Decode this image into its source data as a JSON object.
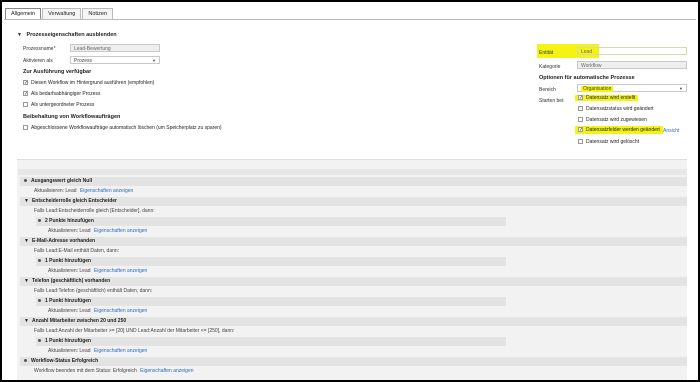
{
  "tabs": [
    "Allgemein",
    "Verwaltung",
    "Notizen"
  ],
  "section_title": "Prozesseigenschaften ausblenden",
  "form": {
    "process_name_label": "Prozessname",
    "required_mark": "*",
    "process_name_value": "Lead-Bewertung",
    "activate_as_label": "Aktivieren als",
    "activate_as_value": "Prozess",
    "run_heading": "Zur Ausführung verfügbar",
    "run_options": [
      {
        "label": "Diesen Workflow im Hintergrund ausführen (empfohlen)",
        "checked": true
      },
      {
        "label": "Als bedarfsabhängiger Prozess",
        "checked": true
      },
      {
        "label": "Als untergeordneter Prozess",
        "checked": false
      }
    ],
    "retention_heading": "Beibehaltung von Workflowaufträgen",
    "retention_option": {
      "label": "Abgeschlossene Workflowaufträge automatisch löschen (um Speicherplatz zu sparen)",
      "checked": false
    }
  },
  "right": {
    "entity_label": "Entität",
    "entity_value": "Lead",
    "category_label": "Kategorie",
    "category_value": "Workflow",
    "options_heading": "Optionen für automatische Prozesse",
    "scope_label": "Bereich",
    "scope_value": "Organisation",
    "start_label": "Starten bei:",
    "start_options": [
      {
        "label": "Datensatz wird erstellt",
        "checked": true,
        "highlight": true
      },
      {
        "label": "Datensatzstatus wird geändert",
        "checked": false,
        "highlight": false
      },
      {
        "label": "Datensatz wird zugewiesen",
        "checked": false,
        "highlight": false
      },
      {
        "label": "Datensatzfelder werden geändert",
        "checked": true,
        "highlight": true
      },
      {
        "label": "Datensatz wird gelöscht",
        "checked": false,
        "highlight": false
      }
    ],
    "select_link": "Ansicht"
  },
  "highlight_color": "#f4f414",
  "steps": [
    {
      "kind": "head",
      "marker": "dot",
      "text": "Ausgangswert gleich Null",
      "indent": 0
    },
    {
      "kind": "sub",
      "text": "Aktualisieren:",
      "entity": "Lead",
      "link": "Eigenschaften anzeigen",
      "indent": 0
    },
    {
      "kind": "head",
      "marker": "tri",
      "text": "Entscheiderrolle gleich Entscheider",
      "indent": 0
    },
    {
      "kind": "sub",
      "text": "Falls Lead:Entscheiderrolle gleich [Entscheider], dann:",
      "indent": 0
    },
    {
      "kind": "head",
      "marker": "dot",
      "text": "2 Punkte hinzufügen",
      "indent": 1
    },
    {
      "kind": "sub",
      "text": "Aktualisieren:",
      "entity": "Lead",
      "link": "Eigenschaften anzeigen",
      "indent": 1
    },
    {
      "kind": "head",
      "marker": "tri",
      "text": "E-Mail-Adresse vorhanden",
      "indent": 0
    },
    {
      "kind": "sub",
      "text": "Falls Lead:E-Mail enthält Daten, dann:",
      "indent": 0
    },
    {
      "kind": "head",
      "marker": "dot",
      "text": "1 Punkt hinzufügen",
      "indent": 1
    },
    {
      "kind": "sub",
      "text": "Aktualisieren:",
      "entity": "Lead",
      "link": "Eigenschaften anzeigen",
      "indent": 1
    },
    {
      "kind": "head",
      "marker": "tri",
      "text": "Telefon (geschäftlich) vorhanden",
      "indent": 0
    },
    {
      "kind": "sub",
      "text": "Falls Lead:Telefon (geschäftlich) enthält Daten, dann:",
      "indent": 0
    },
    {
      "kind": "head",
      "marker": "dot",
      "text": "1 Punkt hinzufügen",
      "indent": 1
    },
    {
      "kind": "sub",
      "text": "Aktualisieren:",
      "entity": "Lead",
      "link": "Eigenschaften anzeigen",
      "indent": 1
    },
    {
      "kind": "head",
      "marker": "tri",
      "text": "Anzahl Mitarbeiter zwischen 20 und 250",
      "indent": 0
    },
    {
      "kind": "sub",
      "text": "Falls Lead:Anzahl der Mitarbeiter >= [20] UND Lead:Anzahl der Mitarbeiter <= [250], dann:",
      "indent": 0
    },
    {
      "kind": "head",
      "marker": "dot",
      "text": "1 Punkt hinzufügen",
      "indent": 1
    },
    {
      "kind": "sub",
      "text": "Aktualisieren:",
      "entity": "Lead",
      "link": "Eigenschaften anzeigen",
      "indent": 1
    },
    {
      "kind": "head",
      "marker": "dot",
      "text": "Workflow-Status Erfolgreich",
      "indent": 0
    },
    {
      "kind": "sub",
      "text": "Workflow beenden mit dem Status:",
      "entity": "Erfolgreich",
      "link": "Eigenschaften anzeigen",
      "indent": 0
    }
  ]
}
